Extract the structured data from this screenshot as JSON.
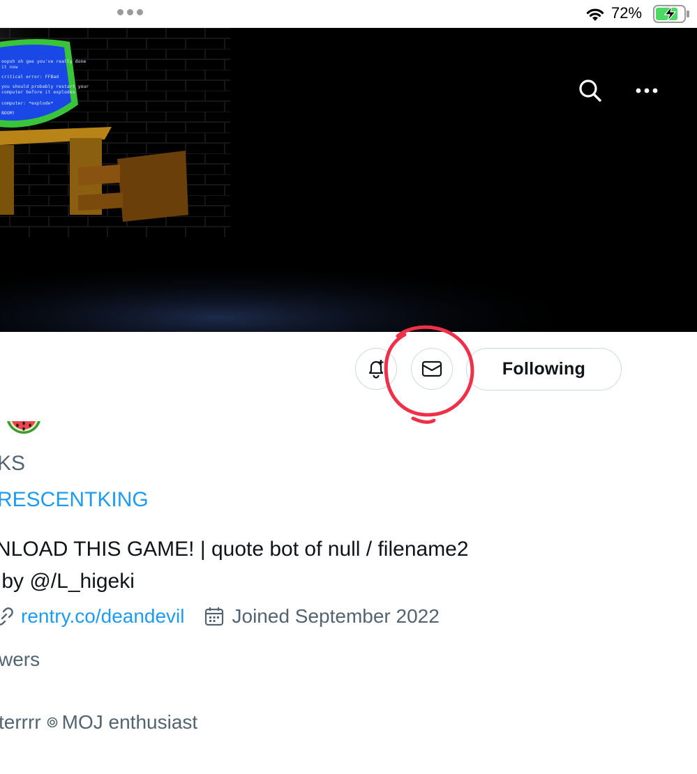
{
  "status_bar": {
    "battery_percent": "72%"
  },
  "profile": {
    "handle_fragment": "KS",
    "link_text_fragment": "RESCENTKING",
    "bio_line1": "NLOAD THIS GAME! | quote bot of null / filename2",
    "bio_line2": " by @/L_higeki",
    "website": "rentry.co/deandevil",
    "joined": "Joined September 2022",
    "followers_fragment": "wers",
    "affiliation_prefix": "terrrr",
    "affiliation_text": "MOJ enthusiast"
  },
  "banner_screen": {
    "lines": [
      "oopsh oh gee you've really done",
      "it now",
      "critical error: FFBad",
      "you should probably restart your",
      "computer before it explodes",
      "computer: *explode*",
      "BOOM!"
    ]
  },
  "actions": {
    "following_label": "Following"
  },
  "colors": {
    "accent": "#1d9bf0",
    "annotation": "#ee3048",
    "muted": "#536471"
  }
}
